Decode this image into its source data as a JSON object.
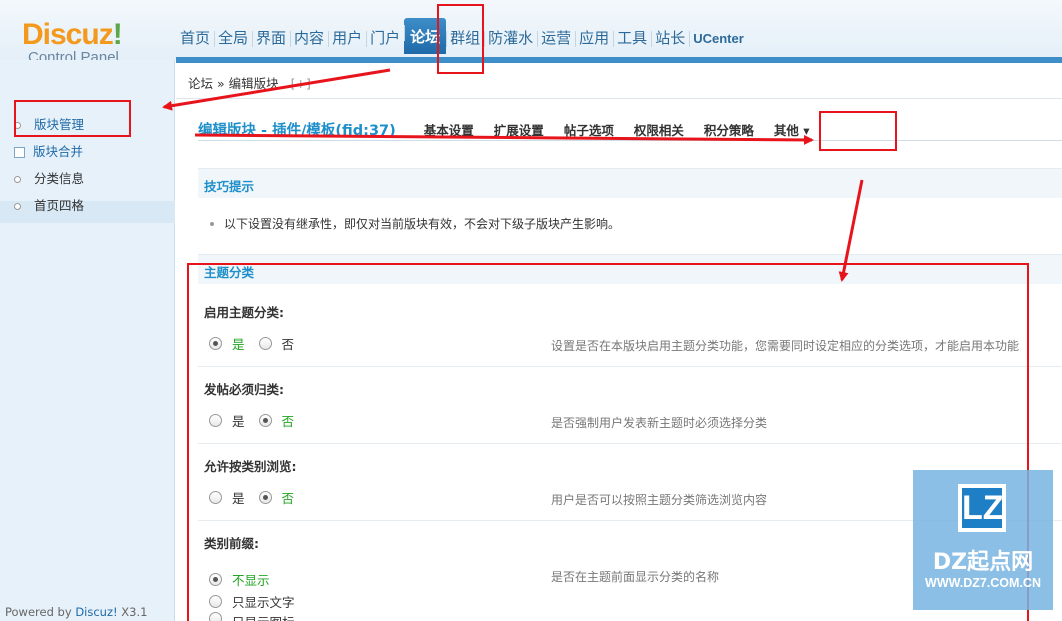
{
  "header": {
    "logo_brand": "Discuz",
    "logo_bang": "!",
    "logo_sub": "Control Panel",
    "nav": [
      "首页",
      "全局",
      "界面",
      "内容",
      "用户",
      "门户",
      "论坛",
      "群组",
      "防灌水",
      "运营",
      "应用",
      "工具",
      "站长",
      "UCenter"
    ],
    "active_nav": "论坛"
  },
  "breadcrumb": {
    "root": "论坛",
    "sep": "»",
    "current": "编辑版块",
    "plus": "[+]"
  },
  "sidebar": {
    "items": [
      {
        "label": "版块管理"
      },
      {
        "label": "版块合并"
      },
      {
        "label": "分类信息"
      },
      {
        "label": "首页四格"
      }
    ],
    "powered_prefix": "Powered by ",
    "powered_link": "Discuz!",
    "powered_version": " X3.1"
  },
  "page": {
    "title": "编辑版块 - 插件/模板(fid:37)",
    "tabs": [
      "基本设置",
      "扩展设置",
      "帖子选项",
      "权限相关",
      "积分策略",
      "其他 ▾"
    ]
  },
  "tips": {
    "heading": "技巧提示",
    "line": "以下设置没有继承性，即仅对当前版块有效，不会对下级子版块产生影响。"
  },
  "section": {
    "heading": "主题分类",
    "fields": [
      {
        "label": "启用主题分类:",
        "yes": "是",
        "no": "否",
        "selected": "yes",
        "desc": "设置是否在本版块启用主题分类功能，您需要同时设定相应的分类选项，才能启用本功能"
      },
      {
        "label": "发帖必须归类:",
        "yes": "是",
        "no": "否",
        "selected": "no",
        "desc": "是否强制用户发表新主题时必须选择分类"
      },
      {
        "label": "允许按类别浏览:",
        "yes": "是",
        "no": "否",
        "selected": "no",
        "desc": "用户是否可以按照主题分类筛选浏览内容"
      },
      {
        "label": "类别前缀:",
        "options": [
          "不显示",
          "只显示文字",
          "只显示图标"
        ],
        "selected": 0,
        "desc": "是否在主题前面显示分类的名称"
      }
    ]
  },
  "watermark": {
    "badge": "LZ",
    "title": "DZ起点网",
    "url": "WWW.DZ7.COM.CN"
  },
  "colors": {
    "annotation": "#e8141c",
    "accent": "#1f8fca",
    "nav_active": "#2b7bbd"
  }
}
